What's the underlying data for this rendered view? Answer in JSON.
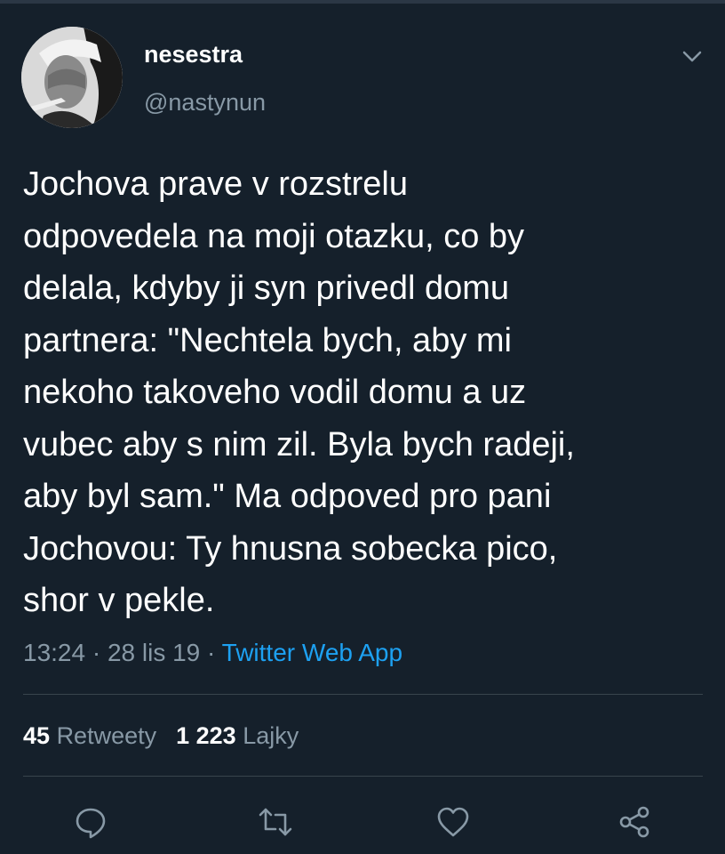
{
  "user": {
    "display_name": "nesestra",
    "handle": "@nastynun",
    "avatar_icon": "avatar-photo"
  },
  "tweet": {
    "text": "Jochova prave v rozstrelu\nodpovedela na moji otazku, co by\ndelala, kdyby ji syn privedl domu\npartnera: \"Nechtela bych, aby mi\nnekoho takoveho vodil domu a uz\nvubec aby s nim zil. Byla bych radeji,\naby byl sam.\" Ma odpoved pro pani\nJochovou: Ty hnusna sobecka pico,\nshor v pekle.",
    "time": "13:24",
    "separator": " · ",
    "date": "28 lis 19",
    "source": "Twitter Web App"
  },
  "stats": {
    "retweets_count": "45",
    "retweets_label": "Retweety",
    "likes_count": "1 223",
    "likes_label": "Lajky"
  },
  "actions": {
    "reply_icon": "reply-icon",
    "retweet_icon": "retweet-icon",
    "like_icon": "heart-icon",
    "share_icon": "share-icon"
  },
  "colors": {
    "background": "#15202b",
    "secondary_text": "#8899a6",
    "link": "#1da1f2",
    "divider": "#38444d"
  }
}
